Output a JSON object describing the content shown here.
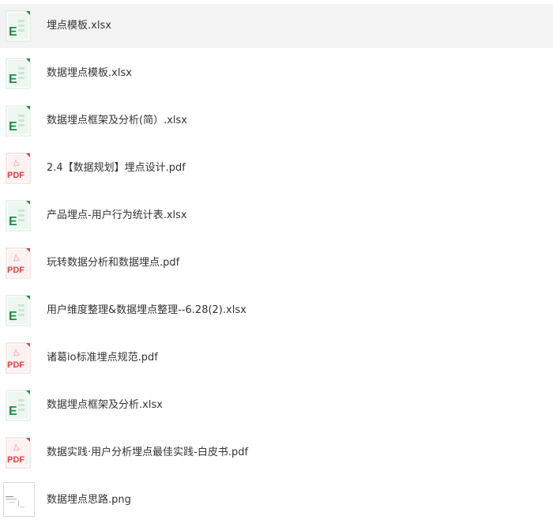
{
  "files": [
    {
      "name": "埋点模板.xlsx",
      "type": "xlsx",
      "icon": "excel-icon",
      "selected": true
    },
    {
      "name": "数据埋点模板.xlsx",
      "type": "xlsx",
      "icon": "excel-icon"
    },
    {
      "name": "数据埋点框架及分析(简）.xlsx",
      "type": "xlsx",
      "icon": "excel-icon"
    },
    {
      "name": "2.4【数据规划】埋点设计.pdf",
      "type": "pdf",
      "icon": "pdf-icon"
    },
    {
      "name": "产品埋点-用户行为统计表.xlsx",
      "type": "xlsx",
      "icon": "excel-icon"
    },
    {
      "name": "玩转数据分析和数据埋点.pdf",
      "type": "pdf",
      "icon": "pdf-icon"
    },
    {
      "name": "用户维度整理&数据埋点整理--6.28(2).xlsx",
      "type": "xlsx",
      "icon": "excel-icon"
    },
    {
      "name": "诸葛io标准埋点规范.pdf",
      "type": "pdf",
      "icon": "pdf-icon"
    },
    {
      "name": "数据埋点框架及分析.xlsx",
      "type": "xlsx",
      "icon": "excel-icon"
    },
    {
      "name": "数据实践·用户分析埋点最佳实践-白皮书.pdf",
      "type": "pdf",
      "icon": "pdf-icon"
    },
    {
      "name": "数据埋点思路.png",
      "type": "png",
      "icon": "image-thumbnail-icon"
    }
  ],
  "colors": {
    "excel_green": "#1d8c4c",
    "pdf_red": "#e04343",
    "selected_bg": "#f3f3f3",
    "text": "#333333"
  },
  "icon_labels": {
    "excel": "E",
    "pdf": "PDF"
  }
}
